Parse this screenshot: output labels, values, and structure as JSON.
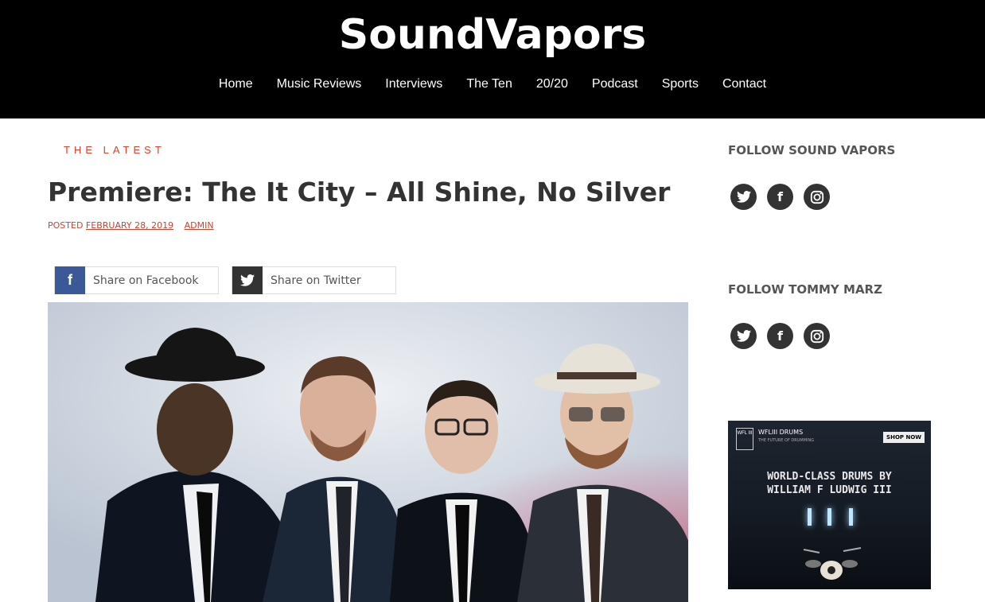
{
  "site": {
    "title": "SoundVapors"
  },
  "nav": [
    "Home",
    "Music Reviews",
    "Interviews",
    "The Ten",
    "20/20",
    "Podcast",
    "Sports",
    "Contact"
  ],
  "post": {
    "eyebrow": "THE LATEST",
    "title": "Premiere: The It City – All Shine, No Silver",
    "posted_label": "POSTED",
    "date": "FEBRUARY 28, 2019",
    "author": "ADMIN"
  },
  "share": {
    "facebook_label": "Share on Facebook",
    "twitter_label": "Share on Twitter"
  },
  "sidebar": {
    "follow_sound_vapors": "FOLLOW SOUND VAPORS",
    "follow_tommy_marz": "FOLLOW TOMMY MARZ"
  },
  "ad": {
    "brand": "WFLIII DRUMS",
    "tagline": "THE FUTURE OF DRUMMING",
    "shop": "SHOP NOW",
    "headline1": "WORLD-CLASS DRUMS BY",
    "headline2": "WILLIAM F LUDWIG III",
    "logo_text": "WFL III"
  },
  "icons": {
    "twitter": "twitter-icon",
    "facebook": "facebook-icon",
    "instagram": "instagram-icon"
  }
}
